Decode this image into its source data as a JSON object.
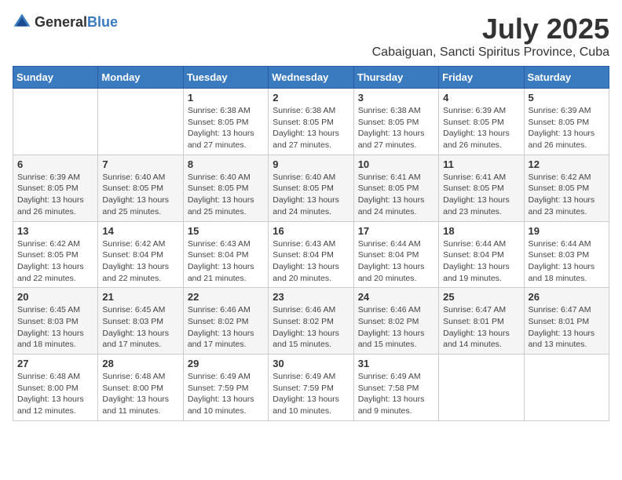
{
  "header": {
    "logo_general": "General",
    "logo_blue": "Blue",
    "month_title": "July 2025",
    "location": "Cabaiguan, Sancti Spiritus Province, Cuba"
  },
  "days_of_week": [
    "Sunday",
    "Monday",
    "Tuesday",
    "Wednesday",
    "Thursday",
    "Friday",
    "Saturday"
  ],
  "weeks": [
    [
      {
        "day": "",
        "info": ""
      },
      {
        "day": "",
        "info": ""
      },
      {
        "day": "1",
        "info": "Sunrise: 6:38 AM\nSunset: 8:05 PM\nDaylight: 13 hours and 27 minutes."
      },
      {
        "day": "2",
        "info": "Sunrise: 6:38 AM\nSunset: 8:05 PM\nDaylight: 13 hours and 27 minutes."
      },
      {
        "day": "3",
        "info": "Sunrise: 6:38 AM\nSunset: 8:05 PM\nDaylight: 13 hours and 27 minutes."
      },
      {
        "day": "4",
        "info": "Sunrise: 6:39 AM\nSunset: 8:05 PM\nDaylight: 13 hours and 26 minutes."
      },
      {
        "day": "5",
        "info": "Sunrise: 6:39 AM\nSunset: 8:05 PM\nDaylight: 13 hours and 26 minutes."
      }
    ],
    [
      {
        "day": "6",
        "info": "Sunrise: 6:39 AM\nSunset: 8:05 PM\nDaylight: 13 hours and 26 minutes."
      },
      {
        "day": "7",
        "info": "Sunrise: 6:40 AM\nSunset: 8:05 PM\nDaylight: 13 hours and 25 minutes."
      },
      {
        "day": "8",
        "info": "Sunrise: 6:40 AM\nSunset: 8:05 PM\nDaylight: 13 hours and 25 minutes."
      },
      {
        "day": "9",
        "info": "Sunrise: 6:40 AM\nSunset: 8:05 PM\nDaylight: 13 hours and 24 minutes."
      },
      {
        "day": "10",
        "info": "Sunrise: 6:41 AM\nSunset: 8:05 PM\nDaylight: 13 hours and 24 minutes."
      },
      {
        "day": "11",
        "info": "Sunrise: 6:41 AM\nSunset: 8:05 PM\nDaylight: 13 hours and 23 minutes."
      },
      {
        "day": "12",
        "info": "Sunrise: 6:42 AM\nSunset: 8:05 PM\nDaylight: 13 hours and 23 minutes."
      }
    ],
    [
      {
        "day": "13",
        "info": "Sunrise: 6:42 AM\nSunset: 8:05 PM\nDaylight: 13 hours and 22 minutes."
      },
      {
        "day": "14",
        "info": "Sunrise: 6:42 AM\nSunset: 8:04 PM\nDaylight: 13 hours and 22 minutes."
      },
      {
        "day": "15",
        "info": "Sunrise: 6:43 AM\nSunset: 8:04 PM\nDaylight: 13 hours and 21 minutes."
      },
      {
        "day": "16",
        "info": "Sunrise: 6:43 AM\nSunset: 8:04 PM\nDaylight: 13 hours and 20 minutes."
      },
      {
        "day": "17",
        "info": "Sunrise: 6:44 AM\nSunset: 8:04 PM\nDaylight: 13 hours and 20 minutes."
      },
      {
        "day": "18",
        "info": "Sunrise: 6:44 AM\nSunset: 8:04 PM\nDaylight: 13 hours and 19 minutes."
      },
      {
        "day": "19",
        "info": "Sunrise: 6:44 AM\nSunset: 8:03 PM\nDaylight: 13 hours and 18 minutes."
      }
    ],
    [
      {
        "day": "20",
        "info": "Sunrise: 6:45 AM\nSunset: 8:03 PM\nDaylight: 13 hours and 18 minutes."
      },
      {
        "day": "21",
        "info": "Sunrise: 6:45 AM\nSunset: 8:03 PM\nDaylight: 13 hours and 17 minutes."
      },
      {
        "day": "22",
        "info": "Sunrise: 6:46 AM\nSunset: 8:02 PM\nDaylight: 13 hours and 17 minutes."
      },
      {
        "day": "23",
        "info": "Sunrise: 6:46 AM\nSunset: 8:02 PM\nDaylight: 13 hours and 15 minutes."
      },
      {
        "day": "24",
        "info": "Sunrise: 6:46 AM\nSunset: 8:02 PM\nDaylight: 13 hours and 15 minutes."
      },
      {
        "day": "25",
        "info": "Sunrise: 6:47 AM\nSunset: 8:01 PM\nDaylight: 13 hours and 14 minutes."
      },
      {
        "day": "26",
        "info": "Sunrise: 6:47 AM\nSunset: 8:01 PM\nDaylight: 13 hours and 13 minutes."
      }
    ],
    [
      {
        "day": "27",
        "info": "Sunrise: 6:48 AM\nSunset: 8:00 PM\nDaylight: 13 hours and 12 minutes."
      },
      {
        "day": "28",
        "info": "Sunrise: 6:48 AM\nSunset: 8:00 PM\nDaylight: 13 hours and 11 minutes."
      },
      {
        "day": "29",
        "info": "Sunrise: 6:49 AM\nSunset: 7:59 PM\nDaylight: 13 hours and 10 minutes."
      },
      {
        "day": "30",
        "info": "Sunrise: 6:49 AM\nSunset: 7:59 PM\nDaylight: 13 hours and 10 minutes."
      },
      {
        "day": "31",
        "info": "Sunrise: 6:49 AM\nSunset: 7:58 PM\nDaylight: 13 hours and 9 minutes."
      },
      {
        "day": "",
        "info": ""
      },
      {
        "day": "",
        "info": ""
      }
    ]
  ]
}
